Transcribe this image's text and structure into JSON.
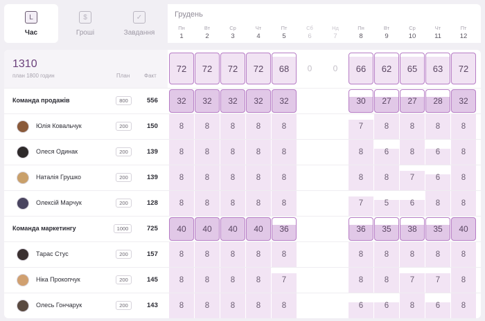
{
  "tabs": [
    {
      "label": "Час",
      "icon": "clock-icon",
      "symbol": "L",
      "active": true
    },
    {
      "label": "Гроші",
      "icon": "money-icon",
      "symbol": "$",
      "active": false
    },
    {
      "label": "Завдання",
      "icon": "task-icon",
      "symbol": "✓",
      "active": false
    }
  ],
  "calendar": {
    "month": "Грудень",
    "days": [
      {
        "dn": "Пн",
        "dd": "1",
        "weekend": false
      },
      {
        "dn": "Вт",
        "dd": "2",
        "weekend": false
      },
      {
        "dn": "Ср",
        "dd": "3",
        "weekend": false
      },
      {
        "dn": "Чт",
        "dd": "4",
        "weekend": false
      },
      {
        "dn": "Пт",
        "dd": "5",
        "weekend": false
      },
      {
        "dn": "Сб",
        "dd": "6",
        "weekend": true
      },
      {
        "dn": "Нд",
        "dd": "7",
        "weekend": true
      },
      {
        "dn": "Пн",
        "dd": "8",
        "weekend": false
      },
      {
        "dn": "Вт",
        "dd": "9",
        "weekend": false
      },
      {
        "dn": "Ср",
        "dd": "10",
        "weekend": false
      },
      {
        "dn": "Чт",
        "dd": "11",
        "weekend": false
      },
      {
        "dn": "Пт",
        "dd": "12",
        "weekend": false
      }
    ]
  },
  "summary": {
    "total": "1310",
    "subtitle": "план 1800 годин",
    "plan_header": "План",
    "fact_header": "Факт",
    "daily_totals": [
      "72",
      "72",
      "72",
      "72",
      "68",
      "0",
      "0",
      "66",
      "62",
      "65",
      "63",
      "72"
    ]
  },
  "rows": [
    {
      "type": "team",
      "name": "Команда продажів",
      "plan": "800",
      "fact": "556",
      "values": [
        "32",
        "32",
        "32",
        "32",
        "32",
        "",
        "",
        "30",
        "27",
        "27",
        "28",
        "32"
      ]
    },
    {
      "type": "person",
      "name": "Юлія Ковальчук",
      "plan": "200",
      "fact": "150",
      "avatar_color": "#8a5a3a",
      "values": [
        "8",
        "8",
        "8",
        "8",
        "8",
        "",
        "",
        "7",
        "8",
        "8",
        "8",
        "8"
      ]
    },
    {
      "type": "person",
      "name": "Олеся Одинак",
      "plan": "200",
      "fact": "139",
      "avatar_color": "#2e2a2a",
      "values": [
        "8",
        "8",
        "8",
        "8",
        "8",
        "",
        "",
        "8",
        "6",
        "8",
        "6",
        "8"
      ]
    },
    {
      "type": "person",
      "name": "Наталія Грушко",
      "plan": "200",
      "fact": "139",
      "avatar_color": "#c9a06a",
      "values": [
        "8",
        "8",
        "8",
        "8",
        "8",
        "",
        "",
        "8",
        "8",
        "7",
        "6",
        "8"
      ]
    },
    {
      "type": "person",
      "name": "Олексій Марчук",
      "plan": "200",
      "fact": "128",
      "avatar_color": "#4a4560",
      "values": [
        "8",
        "8",
        "8",
        "8",
        "8",
        "",
        "",
        "7",
        "5",
        "6",
        "8",
        "8"
      ]
    },
    {
      "type": "team",
      "name": "Команда маркетингу",
      "plan": "1000",
      "fact": "725",
      "values": [
        "40",
        "40",
        "40",
        "40",
        "36",
        "",
        "",
        "36",
        "35",
        "38",
        "35",
        "40"
      ]
    },
    {
      "type": "person",
      "name": "Тарас Стус",
      "plan": "200",
      "fact": "157",
      "avatar_color": "#3a3030",
      "values": [
        "8",
        "8",
        "8",
        "8",
        "8",
        "",
        "",
        "8",
        "8",
        "8",
        "8",
        "8"
      ]
    },
    {
      "type": "person",
      "name": "Ніка Прокопчук",
      "plan": "200",
      "fact": "145",
      "avatar_color": "#d0a070",
      "values": [
        "8",
        "8",
        "8",
        "8",
        "7",
        "",
        "",
        "8",
        "8",
        "7",
        "7",
        "8"
      ]
    },
    {
      "type": "person",
      "name": "Олесь Гончарук",
      "plan": "200",
      "fact": "143",
      "avatar_color": "#5a4a40",
      "values": [
        "8",
        "8",
        "8",
        "8",
        "8",
        "",
        "",
        "6",
        "6",
        "8",
        "6",
        "8"
      ]
    }
  ]
}
